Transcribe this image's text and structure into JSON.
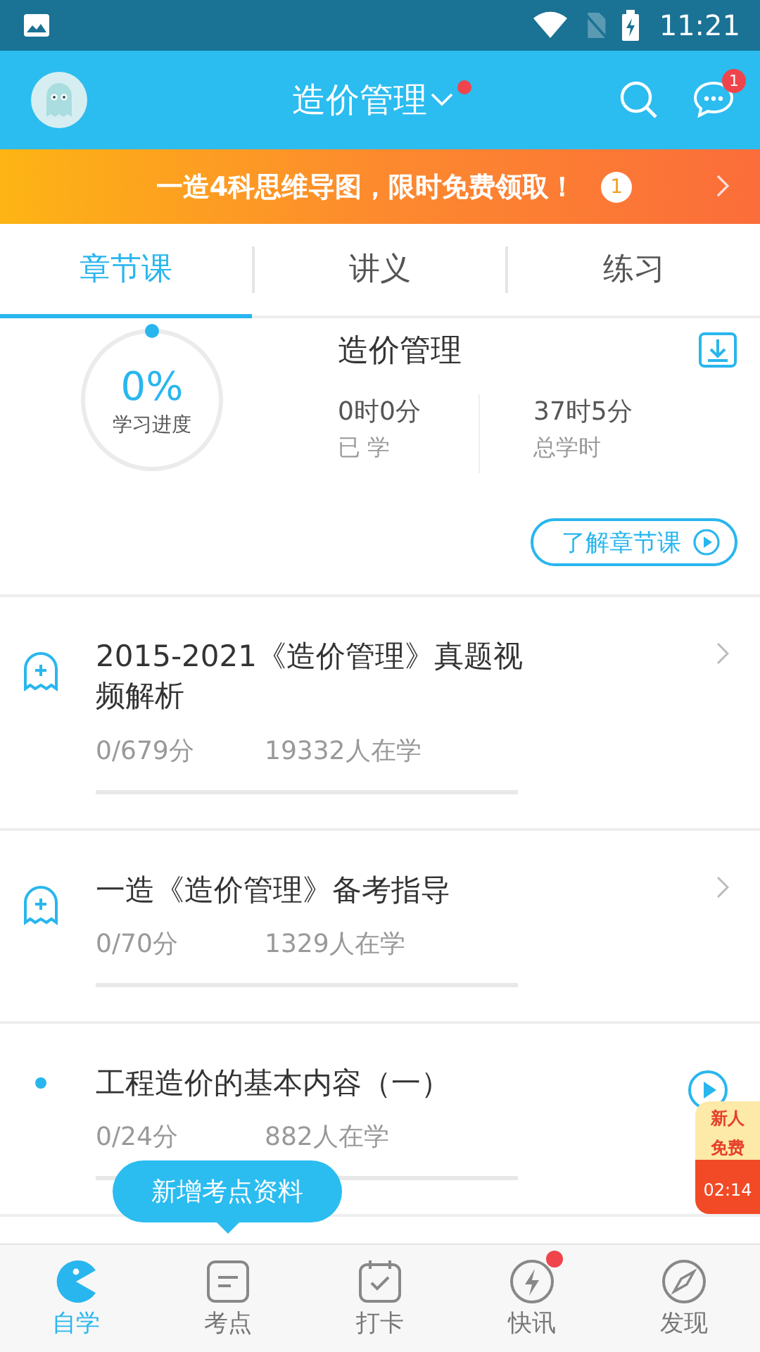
{
  "status_bar": {
    "time": "11:21"
  },
  "header": {
    "title": "造价管理",
    "title_dot": true,
    "messages_badge": "1"
  },
  "banner": {
    "text": "一造4科思维导图，限时免费领取！",
    "badge": "1"
  },
  "tabs": [
    {
      "label": "章节课",
      "selected": true
    },
    {
      "label": "讲义",
      "selected": false
    },
    {
      "label": "练习",
      "selected": false
    }
  ],
  "summary": {
    "progress_value": "0%",
    "progress_label": "学习进度",
    "title": "造价管理",
    "stats": [
      {
        "value": "0时0分",
        "label": "已 学"
      },
      {
        "value": "37时5分",
        "label": "总学时"
      }
    ],
    "intro_button": "了解章节课"
  },
  "courses": [
    {
      "kind": "folder",
      "title": "2015-2021《造价管理》真题视频解析",
      "score": "0/679分",
      "learners": "19332人在学"
    },
    {
      "kind": "folder",
      "title": "一造《造价管理》备考指导",
      "score": "0/70分",
      "learners": "1329人在学"
    },
    {
      "kind": "lesson",
      "title": "工程造价的基本内容（一）",
      "score": "0/24分",
      "learners": "882人在学"
    }
  ],
  "tooltip": "新增考点资料",
  "promo": {
    "line_1": "新人",
    "line_2": "免费",
    "timer": "02:14"
  },
  "nav": [
    {
      "label": "自学",
      "selected": true,
      "dot": false
    },
    {
      "label": "考点",
      "selected": false,
      "dot": false
    },
    {
      "label": "打卡",
      "selected": false,
      "dot": false
    },
    {
      "label": "快讯",
      "selected": false,
      "dot": true
    },
    {
      "label": "发现",
      "selected": false,
      "dot": false
    }
  ]
}
